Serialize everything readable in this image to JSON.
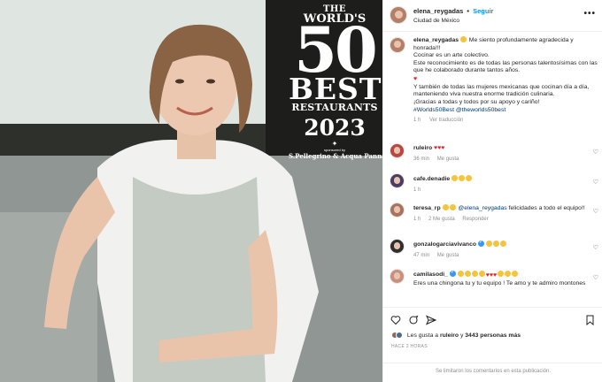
{
  "post": {
    "username": "elena_reygadas",
    "follow_label": "Seguir",
    "location": "Ciudad de México",
    "more_label": "•••"
  },
  "logo": {
    "the": "THE",
    "worlds": "WORLD'S",
    "fifty": "50",
    "best": "BEST",
    "restaurants": "RESTAURANTS",
    "year": "2023",
    "diamond": "✦",
    "sponsored_by": "sponsored by",
    "sponsor": "S.Pellegrino & Acqua Panna"
  },
  "caption": {
    "username": "elena_reygadas",
    "line1": "Me siento profundamente agradecida y honrada!!!",
    "line2": "Cocinar es un arte colectivo.",
    "line3": "Este reconocimiento es de todas las personas talentosísimas con las que he colaborado durante tantos años.",
    "line4": "Y también de todas las mujeres mexicanas que cocinan día a día, manteniendo viva nuestra enorme tradición culinaria.",
    "line5": "¡Gracias a todas y todos por su apoyo y cariño!",
    "hashtags": "#Worlds50Best @theworlds50best",
    "time": "1 h",
    "translation": "Ver traducción"
  },
  "comments": [
    {
      "username": "ruleiro",
      "text": "♥♥♥",
      "time": "36 min",
      "likes": "Me gusta"
    },
    {
      "username": "cafe.denadie",
      "text": "",
      "time": "1 h",
      "likes": ""
    },
    {
      "username": "teresa_rp",
      "mention": "@elena_reygadas",
      "text": "felicidades a todo el equipo!!",
      "time": "1 h",
      "likes": "2 Me gusta",
      "reply": "Responder"
    },
    {
      "username": "gonzalogarciavivanco",
      "text": "",
      "time": "47 min",
      "likes": "Me gusta"
    },
    {
      "username": "camilasodi_",
      "text": "Eres una chingona tu y tu equipo ! Te amo y te admiro montones",
      "time": "",
      "likes": ""
    }
  ],
  "likes": {
    "prefix": "Les gusta a",
    "user": "ruleiro",
    "connector": "y",
    "count": "3443 personas más"
  },
  "date": "HACE 2 HORAS",
  "limited": "Se limitaron los comentarios en esta publicación.",
  "colors": {
    "link": "#0095f6",
    "hashtag": "#00376b",
    "muted": "#8e8e8e",
    "heart_red": "#ed1c24"
  }
}
